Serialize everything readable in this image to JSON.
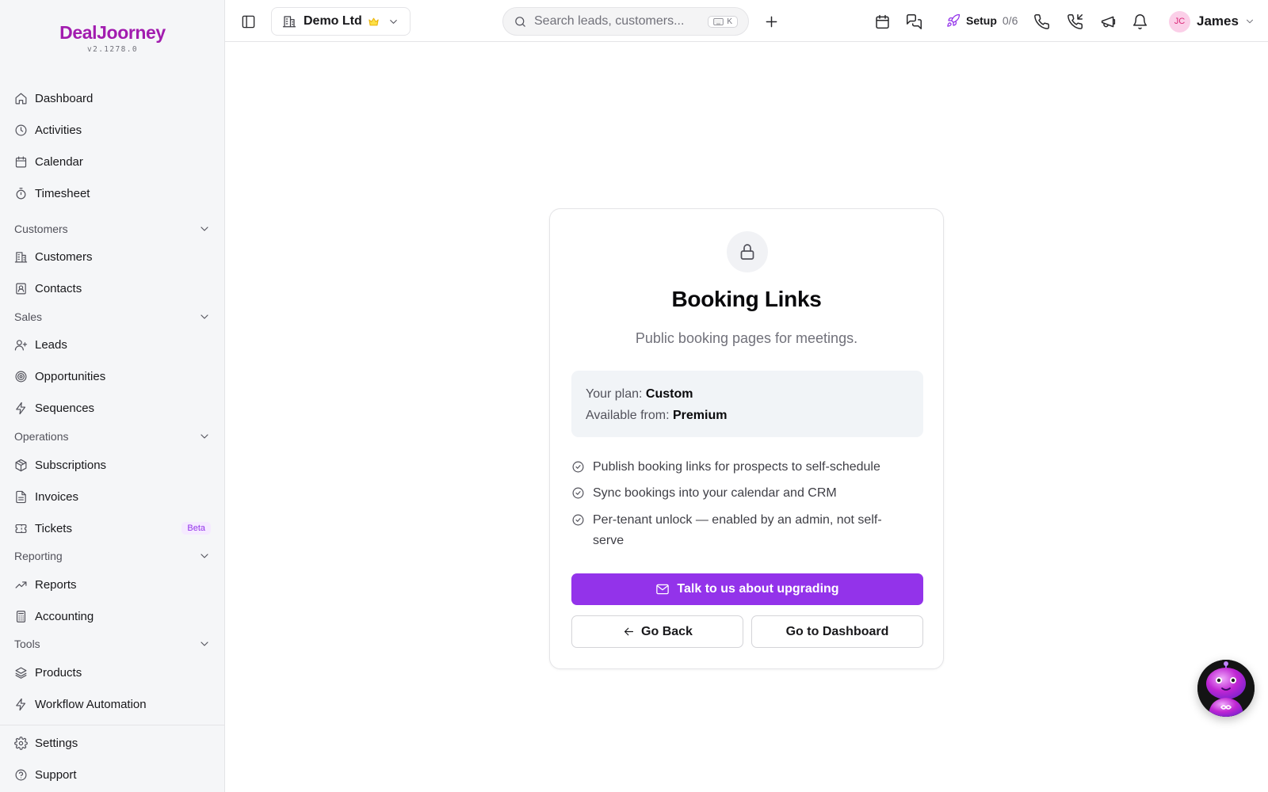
{
  "app": {
    "brand": "DealJoorney",
    "version": "v2.1278.0"
  },
  "sidebar": {
    "items_top": [
      {
        "label": "Dashboard",
        "icon": "home-icon"
      },
      {
        "label": "Activities",
        "icon": "clock-icon"
      },
      {
        "label": "Calendar",
        "icon": "calendar-icon"
      },
      {
        "label": "Timesheet",
        "icon": "stopwatch-icon"
      }
    ],
    "sections": [
      {
        "title": "Customers",
        "items": [
          {
            "label": "Customers",
            "icon": "building-icon"
          },
          {
            "label": "Contacts",
            "icon": "contact-card-icon"
          }
        ]
      },
      {
        "title": "Sales",
        "items": [
          {
            "label": "Leads",
            "icon": "user-plus-icon"
          },
          {
            "label": "Opportunities",
            "icon": "target-icon"
          },
          {
            "label": "Sequences",
            "icon": "zap-icon"
          }
        ]
      },
      {
        "title": "Operations",
        "items": [
          {
            "label": "Subscriptions",
            "icon": "package-icon"
          },
          {
            "label": "Invoices",
            "icon": "file-text-icon"
          },
          {
            "label": "Tickets",
            "icon": "ticket-icon",
            "badge": "Beta"
          }
        ]
      },
      {
        "title": "Reporting",
        "items": [
          {
            "label": "Reports",
            "icon": "trending-up-icon"
          },
          {
            "label": "Accounting",
            "icon": "calculator-icon"
          }
        ]
      },
      {
        "title": "Tools",
        "items": [
          {
            "label": "Products",
            "icon": "layers-icon"
          },
          {
            "label": "Workflow Automation",
            "icon": "zap-icon"
          }
        ]
      }
    ],
    "items_bottom": [
      {
        "label": "Settings",
        "icon": "gear-icon"
      },
      {
        "label": "Support",
        "icon": "help-circle-icon"
      }
    ]
  },
  "header": {
    "tenant": "Demo Ltd",
    "search_placeholder": "Search leads, customers...",
    "search_shortcut": "K",
    "setup_label": "Setup",
    "setup_count": "0/6",
    "user_initials": "JC",
    "user_name": "James"
  },
  "card": {
    "title": "Booking Links",
    "subtitle": "Public booking pages for meetings.",
    "plan_label": "Your plan:",
    "plan_value": "Custom",
    "available_label": "Available from:",
    "available_value": "Premium",
    "features": [
      "Publish booking links for prospects to self-schedule",
      "Sync bookings into your calendar and CRM",
      "Per-tenant unlock — enabled by an admin, not self-serve"
    ],
    "primary_button": "Talk to us about upgrading",
    "back_button": "Go Back",
    "dashboard_button": "Go to Dashboard"
  },
  "colors": {
    "brand": "#a21caf",
    "accent": "#9333ea",
    "sidebar_bg": "#f5f6f8",
    "plan_box_bg": "#f1f4f7"
  }
}
